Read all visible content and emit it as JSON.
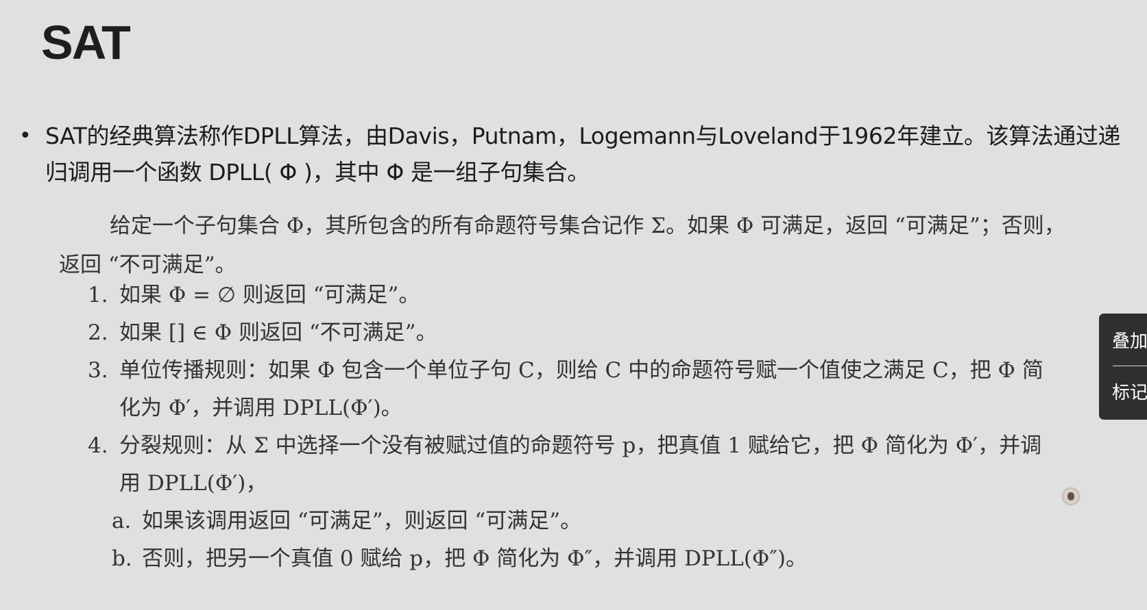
{
  "slide": {
    "title": "SAT",
    "bullet": "SAT的经典算法称作DPLL算法，由Davis，Putnam，Logemann与Loveland于1962年建立。该算法通过递归调用一个函数 DPLL( Φ )，其中 Φ 是一组子句集合。"
  },
  "algorithm": {
    "intro": "给定一个子句集合 Φ，其所包含的所有命题符号集合记作 Σ。如果 Φ 可满足，返回 “可满足”；否则，返回 “不可满足”。",
    "steps": [
      {
        "num": "1.",
        "text": "如果 Φ = ∅ 则返回 “可满足”。"
      },
      {
        "num": "2.",
        "text": "如果 [] ∈ Φ 则返回 “不可满足”。"
      },
      {
        "num": "3.",
        "text": "单位传播规则：如果 Φ 包含一个单位子句 C，则给 C 中的命题符号赋一个值使之满足 C，把 Φ 简化为 Φ′，并调用 DPLL(Φ′)。"
      },
      {
        "num": "4.",
        "text": "分裂规则：从 Σ 中选择一个没有被赋过值的命题符号 p，把真值 1 赋给它，把 Φ 简化为 Φ′，并调用 DPLL(Φ′)，"
      }
    ],
    "substeps": [
      {
        "num": "a.",
        "text": "如果该调用返回 “可满足”，则返回 “可满足”。"
      },
      {
        "num": "b.",
        "text": "否则，把另一个真值 0 赋给 p，把 Φ 简化为 Φ″，并调用 DPLL(Φ″)。"
      }
    ]
  },
  "side_panel": {
    "overlay_label": "叠加",
    "mark_label": "标记"
  },
  "cursor": {
    "icon": "user-avatar-icon"
  }
}
